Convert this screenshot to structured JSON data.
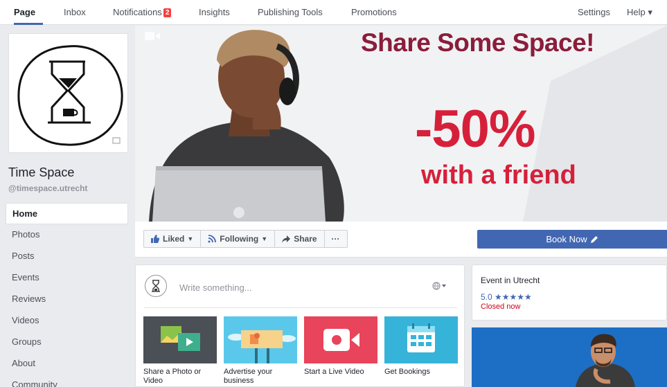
{
  "topnav": {
    "tabs": [
      {
        "label": "Page"
      },
      {
        "label": "Inbox"
      },
      {
        "label": "Notifications",
        "badge": "2"
      },
      {
        "label": "Insights"
      },
      {
        "label": "Publishing Tools"
      },
      {
        "label": "Promotions"
      }
    ],
    "settings": "Settings",
    "help": "Help ▾"
  },
  "page": {
    "name": "Time Space",
    "handle": "@timespace.utrecht"
  },
  "leftnav": {
    "items": [
      {
        "label": "Home"
      },
      {
        "label": "Photos"
      },
      {
        "label": "Posts"
      },
      {
        "label": "Events"
      },
      {
        "label": "Reviews"
      },
      {
        "label": "Videos"
      },
      {
        "label": "Groups"
      },
      {
        "label": "About"
      },
      {
        "label": "Community"
      }
    ]
  },
  "cover": {
    "headline": "Share Some Space!",
    "discount": "-50%",
    "subline": "with a friend"
  },
  "actions": {
    "liked": "Liked",
    "following": "Following",
    "share": "Share",
    "more": "···",
    "book_now": "Book Now"
  },
  "composer": {
    "placeholder": "Write something...",
    "tiles": [
      {
        "label": "Share a Photo or Video",
        "color": "#4b4f56"
      },
      {
        "label": "Advertise your business",
        "color": "#5ac8eb"
      },
      {
        "label": "Start a Live Video",
        "color": "#e8445b"
      },
      {
        "label": "Get Bookings",
        "color": "#36b3d9"
      }
    ]
  },
  "event": {
    "title": "Event in Utrecht",
    "rating": "5.0 ★★★★★",
    "status": "Closed now"
  },
  "colors": {
    "brand": "#4267b2",
    "headline": "#8b1d3b",
    "accent_red": "#d6203a"
  }
}
